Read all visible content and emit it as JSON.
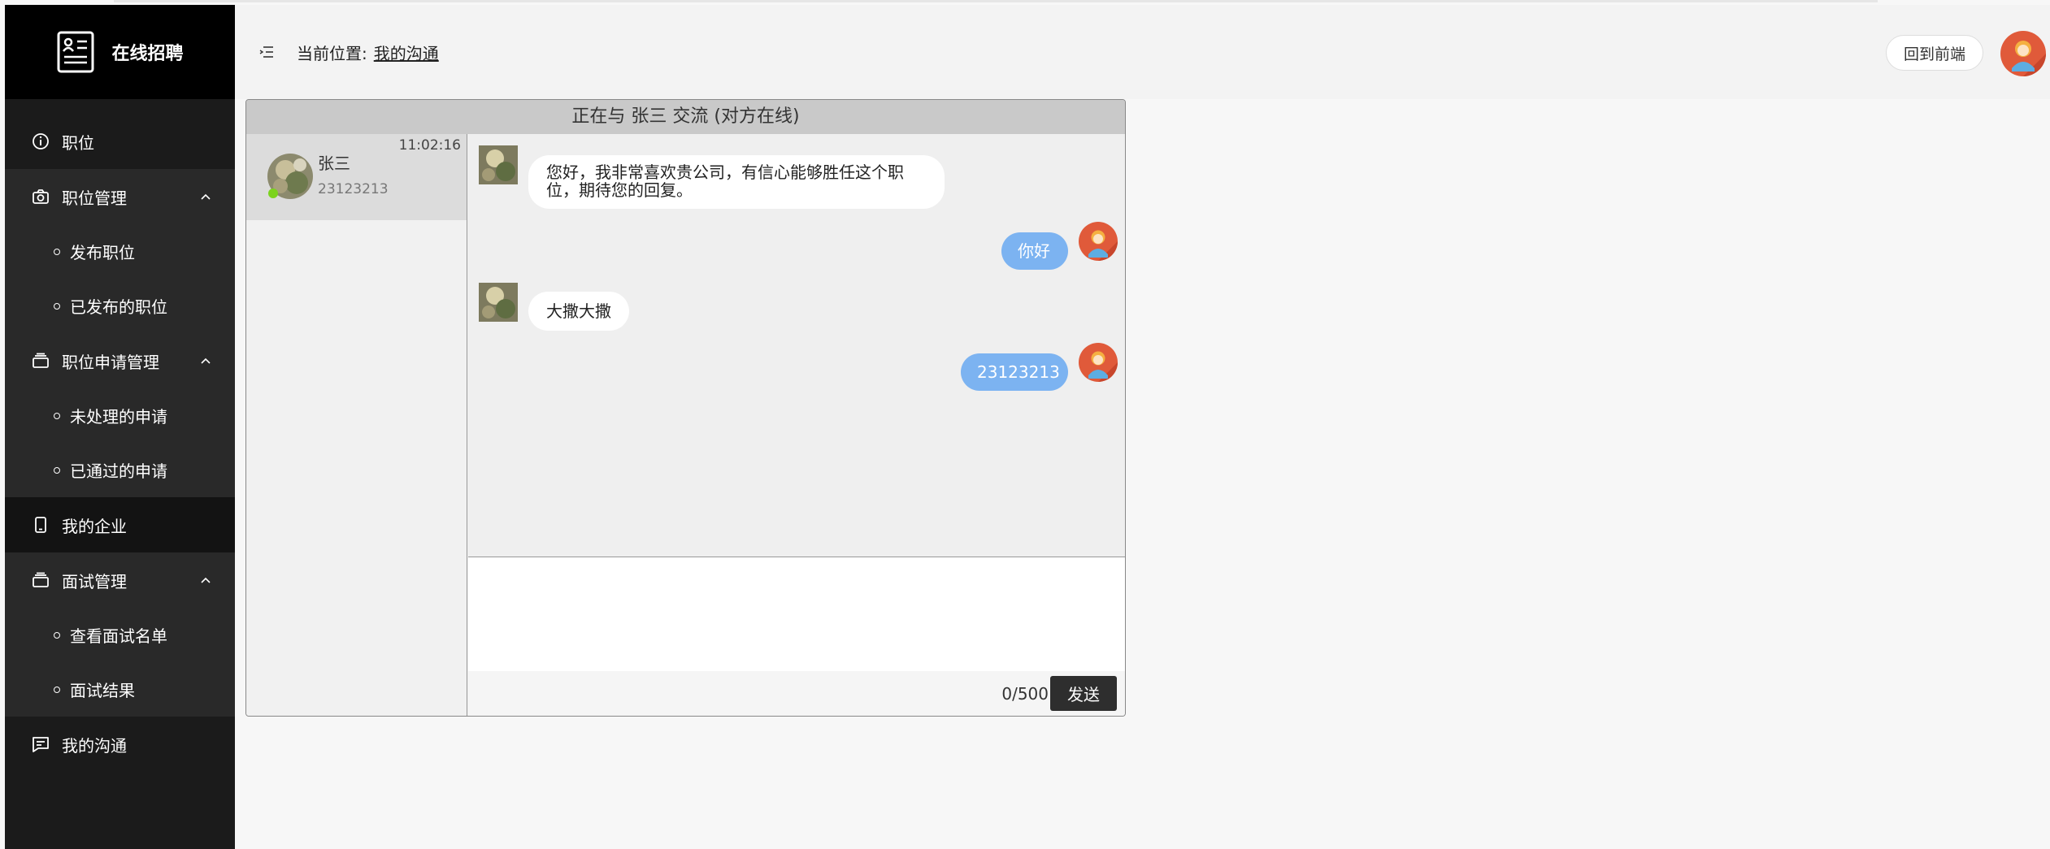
{
  "app": {
    "title": "在线招聘"
  },
  "sidebar": {
    "items": [
      {
        "label": "职位"
      },
      {
        "label": "职位管理",
        "children": [
          {
            "label": "发布职位"
          },
          {
            "label": "已发布的职位"
          }
        ]
      },
      {
        "label": "职位申请管理",
        "children": [
          {
            "label": "未处理的申请"
          },
          {
            "label": "已通过的申请"
          }
        ]
      },
      {
        "label": "我的企业"
      },
      {
        "label": "面试管理",
        "children": [
          {
            "label": "查看面试名单"
          },
          {
            "label": "面试结果"
          }
        ]
      },
      {
        "label": "我的沟通"
      }
    ]
  },
  "header": {
    "breadcrumb_prefix": "当前位置:",
    "breadcrumb_current": "我的沟通",
    "back_button": "回到前端"
  },
  "chat": {
    "title": "正在与 张三 交流 (对方在线)",
    "contact": {
      "name": "张三",
      "last_message": "23123213",
      "time": "11:02:16",
      "online": true
    },
    "messages": [
      {
        "side": "left",
        "text": "您好，我非常喜欢贵公司，有信心能够胜任这个职位，期待您的回复。"
      },
      {
        "side": "right",
        "text": "你好"
      },
      {
        "side": "left",
        "text": "大撒大撒"
      },
      {
        "side": "right",
        "text": "23123213"
      }
    ],
    "counter": "0/500",
    "send_label": "发送"
  },
  "colors": {
    "sidebar_bg": "#1b1b1b",
    "logo_bg": "#000000",
    "bubble_right": "#7cb3f1",
    "online": "#7cd31e",
    "send_button": "#2e2e2e"
  }
}
